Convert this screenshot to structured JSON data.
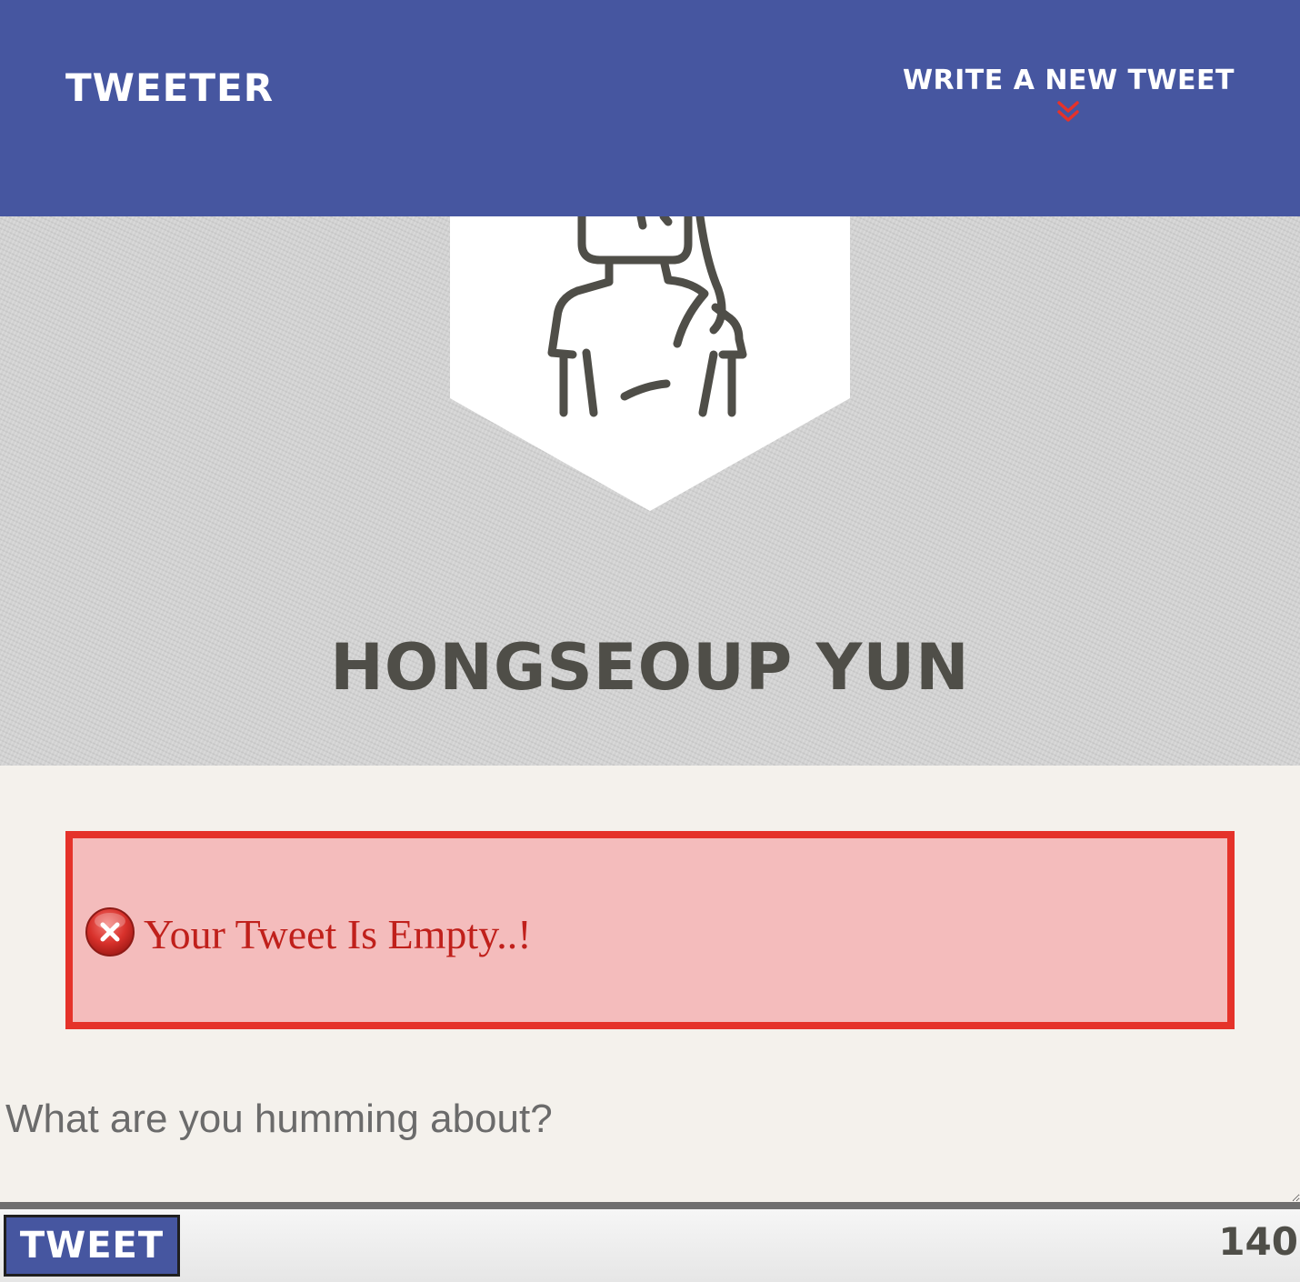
{
  "nav": {
    "brand": "TWEETER",
    "compose_label": "WRITE A NEW TWEET",
    "compose_icon": "double-chevron-down-icon",
    "accent_color": "#e5322a",
    "bar_color": "#4656a0"
  },
  "profile": {
    "name": "HONGSEOUP YUN",
    "avatar_icon": "user-avatar-icon"
  },
  "error": {
    "message": "Your Tweet Is Empty..!",
    "icon": "error-x-icon",
    "border_color": "#e5322a",
    "background_color": "#f4bcbc"
  },
  "composer": {
    "placeholder": "What are you humming about?",
    "value": "",
    "submit_label": "TWEET",
    "counter": "140"
  }
}
